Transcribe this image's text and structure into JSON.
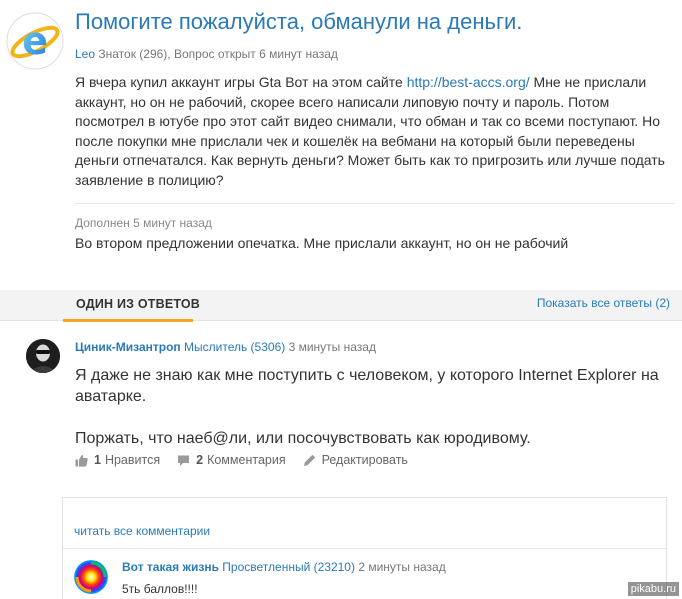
{
  "question": {
    "title": "Помогите пожалуйста, обманули на деньги.",
    "author": "Leo",
    "author_rank": "Знаток (296),",
    "status": "Вопрос открыт 6 минут назад",
    "body_before_link": "Я вчера купил аккаунт игры Gta Вот на этом сайте",
    "link": "http://best-accs.org/",
    "body_after_link": "Мне не прислали аккаунт, но он не рабочий, скорее всего написали липовую почту и пароль. Потом посмотрел в ютубе про этот сайт видео снимали, что обман и так со всеми поступают. Но после покупки мне прислали чек и кошелёк на вебмани на который были переведены деньги отпечатался. Как вернуть деньги? Может быть как то пригрозить или лучше подать заявление в полицию?",
    "supplement_label": "Дополнен 5 минут назад",
    "supplement_text": "Во втором предложении опечатка. Мне прислали аккаунт, но он не рабочий"
  },
  "answers_bar": {
    "title": "ОДИН ИЗ ОТВЕТОВ",
    "show_all": "Показать все ответы (2)"
  },
  "answer": {
    "author": "Циник-Мизантроп",
    "rank": "Мыслитель (5306)",
    "time": "3 минуты назад",
    "paragraph1": "Я даже не знаю как мне поступить с человеком, у которого Internet Explorer на аватарке.",
    "paragraph2": "Поржать, что наеб@ли, или посочувствовать как юродивому.",
    "likes_count": "1",
    "likes_label": "Нравится",
    "comments_count": "2",
    "comments_label": "Комментария",
    "edit_label": "Редактировать"
  },
  "comments": {
    "read_all": "читать все комментарии",
    "items": [
      {
        "author": "Вот такая жизнь",
        "rank": "Просветленный (23210)",
        "time": "2 минуты назад",
        "text": "5ть баллов!!!!"
      }
    ]
  },
  "watermark": "pikabu.ru",
  "colors": {
    "link": "#2a7ab7",
    "accent": "#f5a623",
    "bar_bg": "#f3f3f3"
  }
}
